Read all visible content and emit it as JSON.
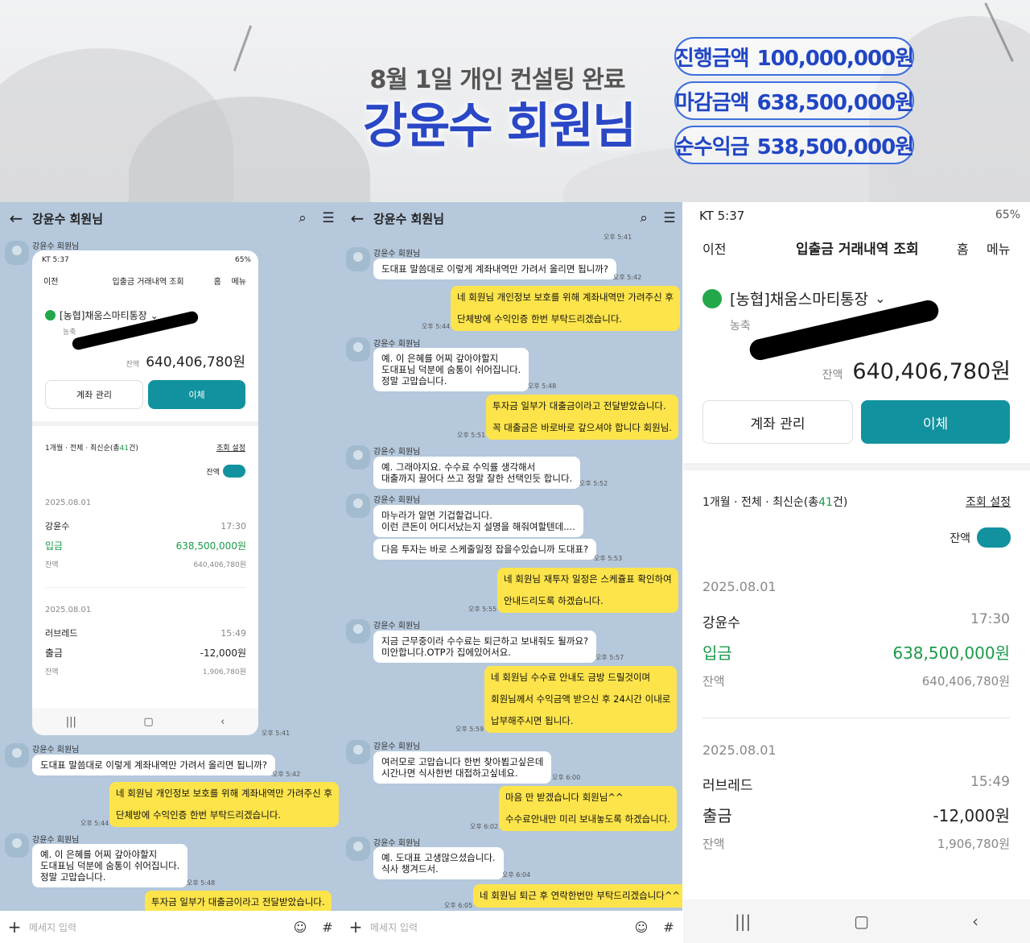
{
  "banner": {
    "subtitle": "8월 1일 개인 컨설팅 완료",
    "title": "강윤수 회원님",
    "pills": [
      {
        "label": "진행금액",
        "value": "100,000,000원"
      },
      {
        "label": "마감금액",
        "value": "638,500,000원"
      },
      {
        "label": "순수익금",
        "value": "538,500,000원"
      }
    ]
  },
  "chat1": {
    "title": "강윤수 회원님",
    "sender": "강윤수 회원님",
    "ts_image": "오후 5:41",
    "msgs": [
      {
        "text": "도대표 말씀대로 이렇게 계좌내역만 가려서 올리면 됩니까?",
        "ts": "오후 5:42"
      },
      {
        "l1": "네 회원님 개인정보 보호를 위해 계좌내역만 가려주신 후",
        "l2": "단체방에 수익인증 한번 부탁드리겠습니다.",
        "ts": "오후 5:44"
      },
      {
        "l1": "예. 이 은혜를 어찌 갚아야할지",
        "l2": "도대표님 덕분에 숨통이 쉬어집니다.",
        "l3": "정말 고맙습니다.",
        "ts": "오후 5:48"
      },
      {
        "text": "투자금 일부가 대출금이라고 전달받았습니다."
      }
    ],
    "input_placeholder": "메세지 입력"
  },
  "chat2": {
    "title": "강윤수 회원님",
    "sender": "강윤수 회원님",
    "ts_top": "오후 5:41",
    "m1": {
      "text": "도대표 말씀대로 이렇게 계좌내역만 가려서 올리면 됩니까?",
      "ts": "오후 5:42"
    },
    "m2": {
      "l1": "네 회원님 개인정보 보호를 위해 계좌내역만 가려주신 후",
      "l2": "단체방에 수익인증 한번 부탁드리겠습니다.",
      "ts": "오후 5:44"
    },
    "m3": {
      "l1": "예. 이 은혜를 어찌 갚아야할지",
      "l2": "도대표님 덕분에 숨통이 쉬어집니다.",
      "l3": "정말 고맙습니다.",
      "ts": "오후 5:48"
    },
    "m4": {
      "l1": "투자금 일부가 대출금이라고 전달받았습니다.",
      "l2": "꼭 대출금은 바로바로 갚으셔야 합니다 회원님.",
      "ts": "오후 5:51"
    },
    "m5": {
      "l1": "예. 그래야지요. 수수료 수익률 생각해서",
      "l2": "대출까지 끌어다 쓰고 정말 잘한 선택인듯 합니다.",
      "ts": "오후 5:52"
    },
    "m6": {
      "l1": "마누라가 알면 기겁할겁니다.",
      "l2": "이런 큰돈이 어디서났는지 설명을 해줘여할텐데....",
      "l3": "다음 투자는 바로 스케줄일정 잡을수있습니까 도대표?",
      "ts": "오후 5:53"
    },
    "m7": {
      "l1": "네 회원님 재투자 일정은 스케쥴표 확인하여",
      "l2": "안내드리도록 하겠습니다.",
      "ts": "오후 5:55"
    },
    "m8": {
      "l1": "지금 근무중이라 수수료는 퇴근하고 보내줘도 될까요?",
      "l2": "미안합니다.OTP가 집에있어서요.",
      "ts": "오후 5:57"
    },
    "m9": {
      "l1": "네 회원님 수수료 안내도 금방 드릴것이며",
      "l2": "회원님께서 수익금액 받으신 후 24시간 이내로",
      "l3": "납부해주시면 됩니다.",
      "ts": "오후 5:59"
    },
    "m10": {
      "l1": "여러모로 고맙습니다 한번 찾아뵙고싶은데",
      "l2": "시간나면 식사한번 대접하고싶네요.",
      "ts": "오후 6:00"
    },
    "m11": {
      "l1": "마음 만 받겠습니다 회원님^^",
      "l2": "수수료안내만 미리 보내놓도록 하겠습니다.",
      "ts": "오후 6:02"
    },
    "m12": {
      "l1": "예. 도대표 고생많으셨습니다.",
      "l2": "식사 챙겨드서.",
      "ts": "오후 6:04"
    },
    "m13": {
      "text": "네 회원님 퇴근 후 연락한번만 부탁드리겠습니다^^",
      "ts": "오후 6:05"
    },
    "input_placeholder": "메세지 입력"
  },
  "bank": {
    "carrier_time": "KT 5:37",
    "battery": "65%",
    "nav_prev": "이전",
    "nav_title": "입출금 거래내역 조회",
    "nav_home": "홈",
    "nav_menu": "메뉴",
    "account_name": "[농협]채움스마티통장",
    "account_sub": "농축",
    "balance_label": "잔액",
    "balance": "640,406,780원",
    "btn_manage": "계좌 관리",
    "btn_transfer": "이체",
    "filter_prefix": "1개월 · 전체 · 최신순(총",
    "filter_count": "41",
    "filter_suffix": "건)",
    "filter_link": "조회 설정",
    "toggle_label": "잔액",
    "tx": [
      {
        "date": "2025.08.01",
        "name": "강윤수",
        "time": "17:30",
        "type": "입금",
        "amount": "638,500,000원",
        "bal_label": "잔액",
        "bal": "640,406,780원"
      },
      {
        "date": "2025.08.01",
        "name": "러브레드",
        "time": "15:49",
        "type": "출금",
        "amount": "-12,000원",
        "bal_label": "잔액",
        "bal": "1,906,780원"
      }
    ]
  },
  "colors": {
    "accent_teal": "#12929e",
    "deposit_green": "#1a9a49",
    "chat_bg": "#b5c8dc",
    "bubble_yellow": "#fde44a",
    "banner_blue": "#2a47c6"
  }
}
